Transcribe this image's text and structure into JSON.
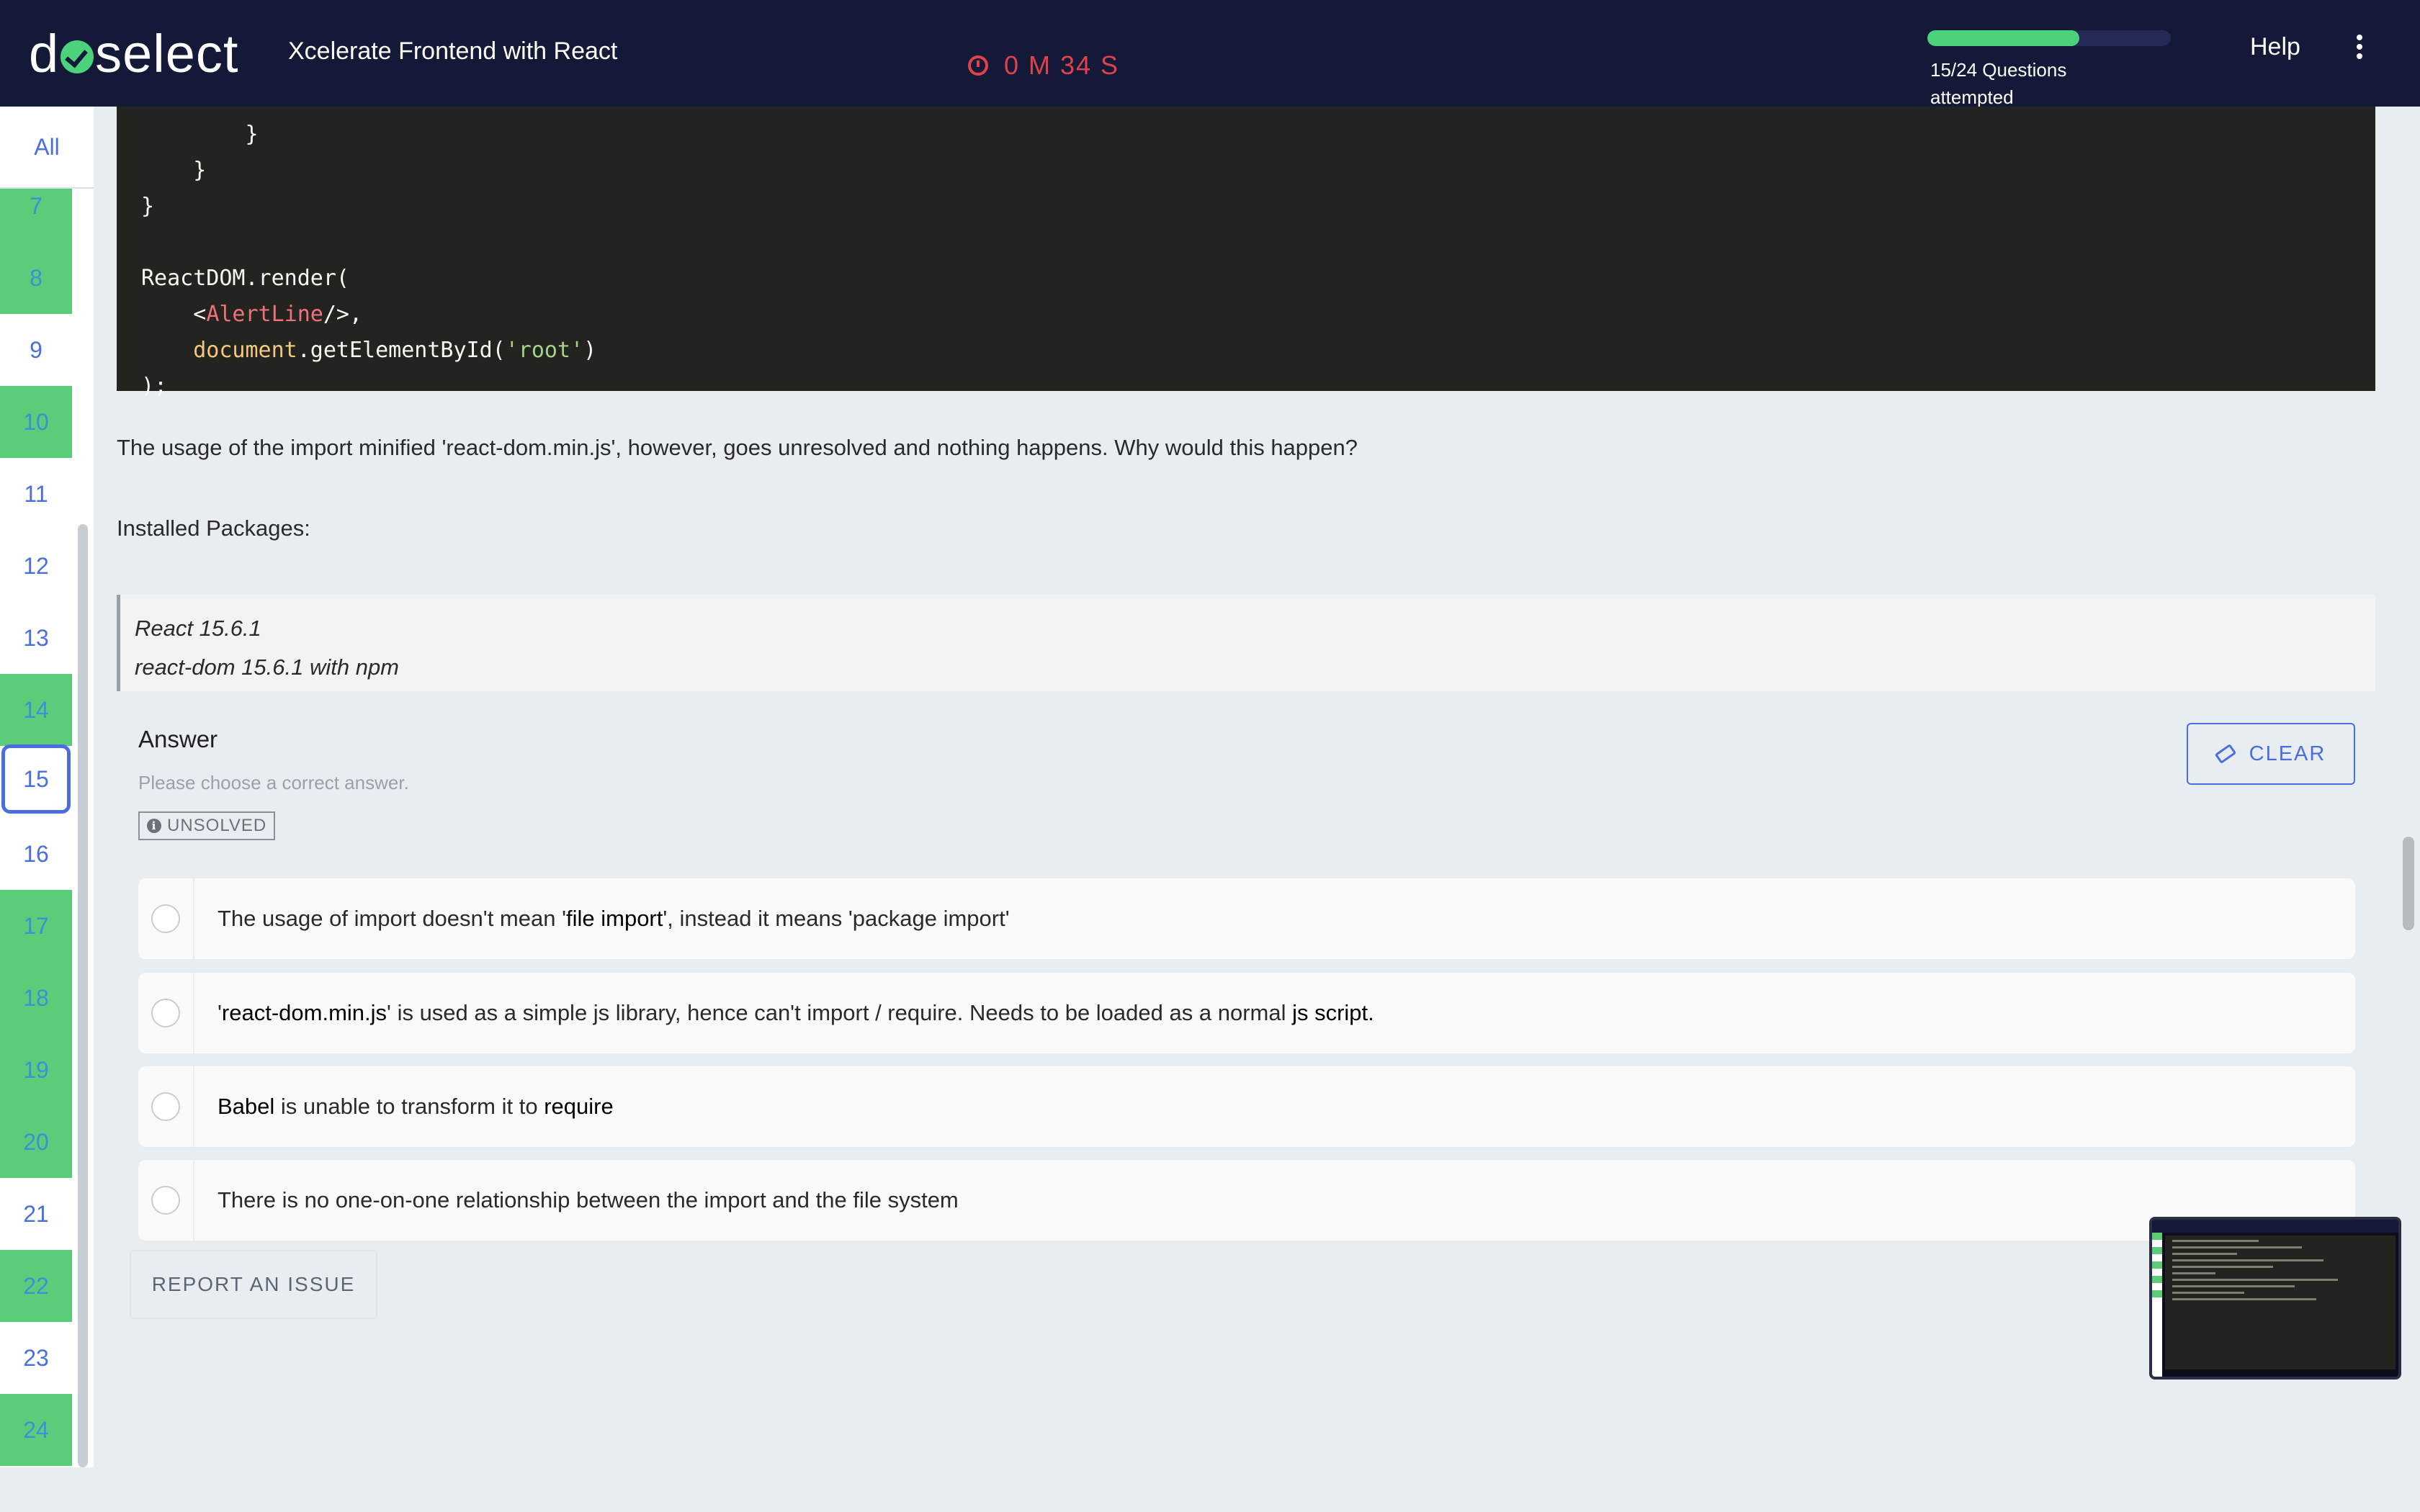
{
  "header": {
    "logo_text": "doselect",
    "course_title": "Xcelerate Frontend with React",
    "timer": "0 M 34 S",
    "progress_fraction": 0.625,
    "progress_label": "15/24 Questions attempted",
    "help_label": "Help",
    "menu_icon": "kebab-menu-icon"
  },
  "sidebar": {
    "filter_all": "All",
    "questions": [
      {
        "number": "7",
        "state": "done"
      },
      {
        "number": "8",
        "state": "done"
      },
      {
        "number": "9",
        "state": "unattempted"
      },
      {
        "number": "10",
        "state": "done"
      },
      {
        "number": "11",
        "state": "unattempted"
      },
      {
        "number": "12",
        "state": "unattempted"
      },
      {
        "number": "13",
        "state": "unattempted"
      },
      {
        "number": "14",
        "state": "done"
      },
      {
        "number": "15",
        "state": "current"
      },
      {
        "number": "16",
        "state": "unattempted"
      },
      {
        "number": "17",
        "state": "done"
      },
      {
        "number": "18",
        "state": "done"
      },
      {
        "number": "19",
        "state": "done"
      },
      {
        "number": "20",
        "state": "done"
      },
      {
        "number": "21",
        "state": "unattempted"
      },
      {
        "number": "22",
        "state": "done"
      },
      {
        "number": "23",
        "state": "unattempted"
      },
      {
        "number": "24",
        "state": "done"
      }
    ],
    "colors": {
      "done": "#5ccb7a",
      "current_border": "#4a6ee0",
      "number": "#4a6ee0"
    }
  },
  "question": {
    "code_lines": [
      "        }",
      "    }",
      "}",
      "",
      "ReactDOM.render(",
      "    <AlertLine/>,",
      "    document.getElementById('root')",
      ");"
    ],
    "text": "The usage of the import minified 'react-dom.min.js', however, goes unresolved and nothing happens. Why would this happen?",
    "installed_label": "Installed Packages:",
    "packages": [
      "React 15.6.1",
      "react-dom 15.6.1 with npm"
    ]
  },
  "answer": {
    "title": "Answer",
    "hint": "Please choose a correct answer.",
    "status": "UNSOLVED",
    "clear_label": "CLEAR",
    "options": [
      {
        "prefix": "The usage of import doesn't mean '",
        "em": "file import",
        "suffix": "', instead it means 'package import'"
      },
      {
        "prefix": "'",
        "em": "react-dom.min.js",
        "suffix": "' is used as a simple js library, hence can't import / require. Needs to be loaded as a normal ",
        "em2": "js script."
      },
      {
        "prefix": "",
        "em": "Babel",
        "suffix": " is unable to transform it to ",
        "em2": "require"
      },
      {
        "prefix": "There is no one-on-one relationship between the import and the file system",
        "em": "",
        "suffix": ""
      }
    ],
    "report_label": "REPORT AN ISSUE"
  }
}
